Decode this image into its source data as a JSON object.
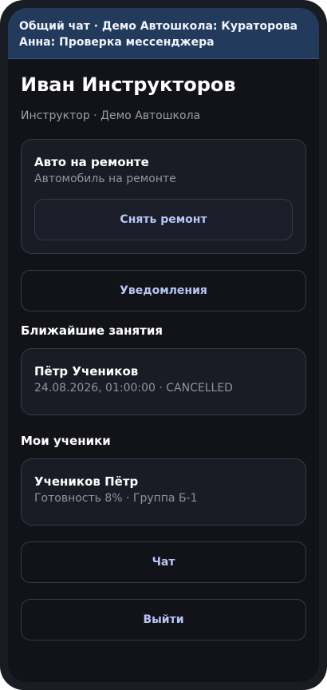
{
  "banner": {
    "text": "Общий чат · Демо Автошкола: Кураторова Анна: Проверка мессенджера"
  },
  "profile": {
    "name": "Иван Инструкторов",
    "role": "Инструктор · Демо Автошкола"
  },
  "car_status": {
    "title": "Авто на ремонте",
    "subtitle": "Автомобиль на ремонте",
    "action_label": "Снять ремонт"
  },
  "notifications_label": "Уведомления",
  "lessons": {
    "section_title": "Ближайшие занятия",
    "items": [
      {
        "name": "Пётр Учеников",
        "details": "24.08.2026, 01:00:00 · CANCELLED"
      }
    ]
  },
  "students": {
    "section_title": "Мои ученики",
    "items": [
      {
        "name": "Учеников Пётр",
        "details": "Готовность 8% · Группа Б-1"
      }
    ]
  },
  "chat_label": "Чат",
  "logout_label": "Выйти"
}
